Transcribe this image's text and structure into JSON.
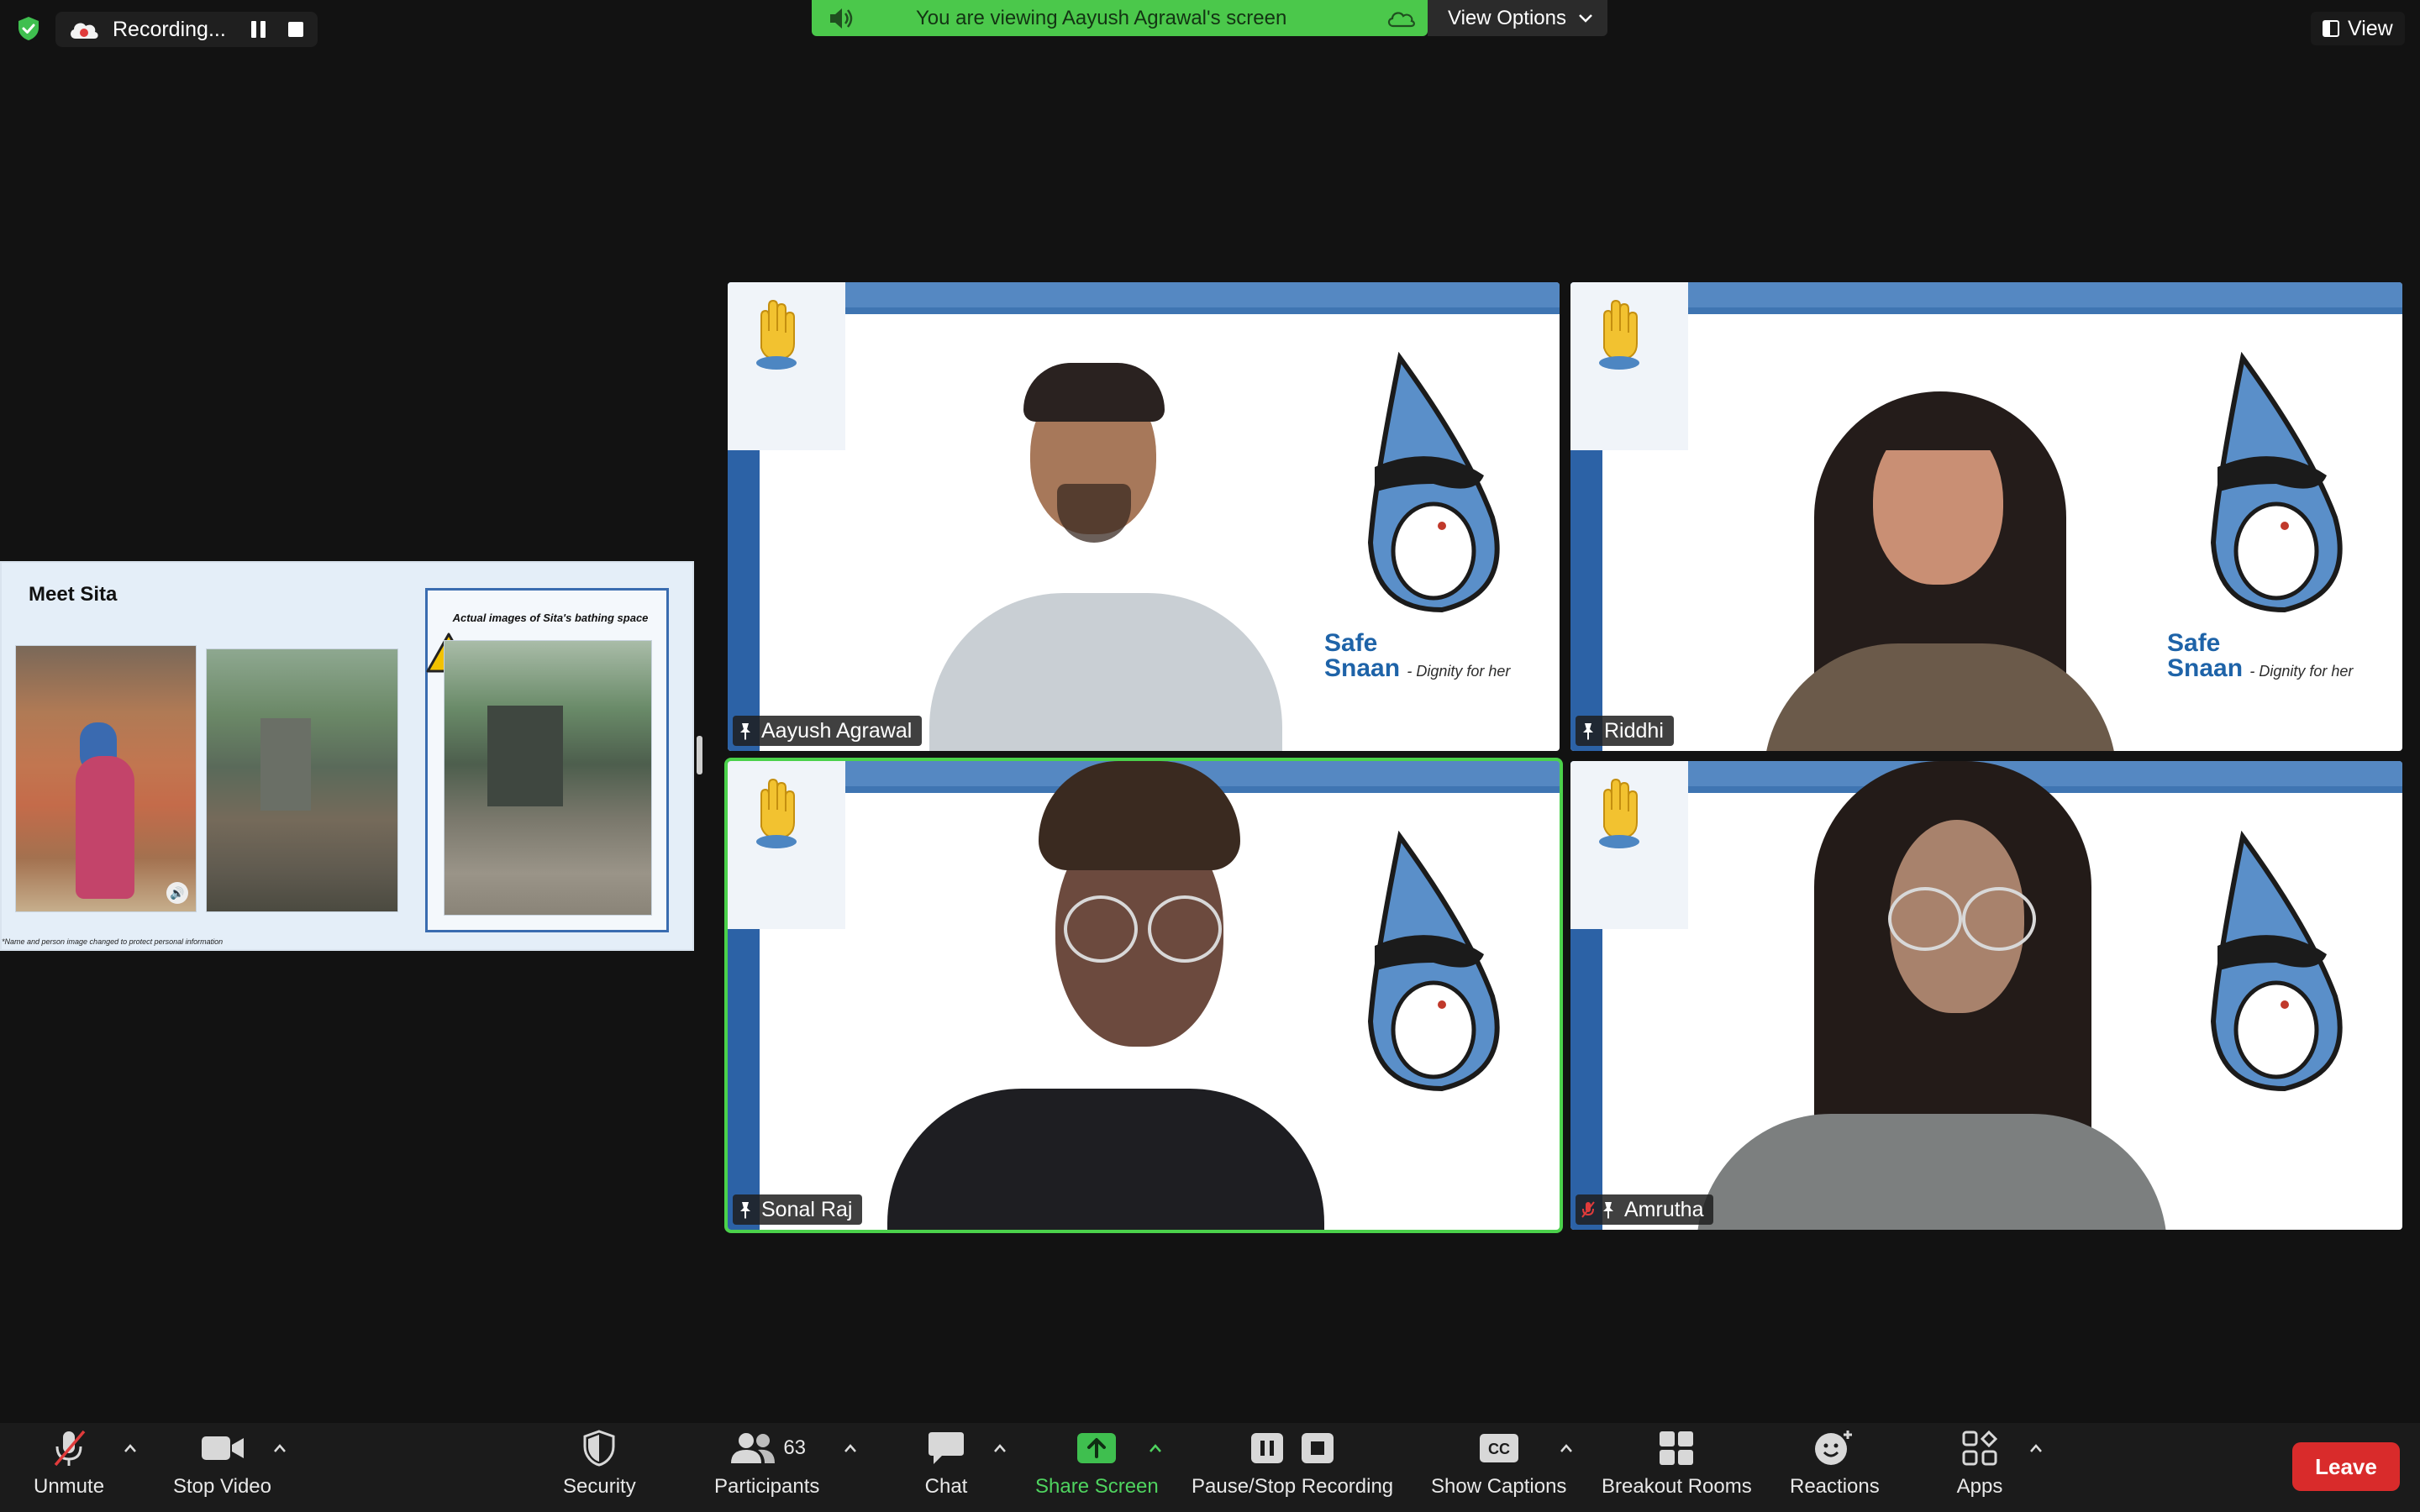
{
  "top_bar": {
    "recording_label": "Recording...",
    "viewing_message": "You are viewing Aayush Agrawal's screen",
    "view_options_label": "View Options",
    "view_label": "View"
  },
  "shared_slide": {
    "title": "Meet Sita",
    "frame_caption": "Actual images of Sita's bathing space",
    "footnote": "*Name and person image changed to protect personal information"
  },
  "tile_branding": {
    "line1": "Safe",
    "line2": "Snaan",
    "tagline": "- Dignity for her"
  },
  "participants": [
    {
      "name": "Aayush Agrawal",
      "muted": false,
      "active_speaker": false
    },
    {
      "name": "Riddhi",
      "muted": false,
      "active_speaker": false
    },
    {
      "name": "Sonal Raj",
      "muted": false,
      "active_speaker": true
    },
    {
      "name": "Amrutha",
      "muted": true,
      "active_speaker": false
    }
  ],
  "toolbar": {
    "unmute": "Unmute",
    "stop_video": "Stop Video",
    "security": "Security",
    "participants": "Participants",
    "participant_count": "63",
    "chat": "Chat",
    "share_screen": "Share Screen",
    "pause_stop_recording": "Pause/Stop Recording",
    "show_captions": "Show Captions",
    "breakout_rooms": "Breakout Rooms",
    "reactions": "Reactions",
    "apps": "Apps",
    "leave": "Leave",
    "captions_glyph": "CC"
  },
  "colors": {
    "viewing_banner": "#4bc84b",
    "active_border": "#4bd14b",
    "share_icon": "#3fbf4f",
    "leave_button": "#d92b2b",
    "slide_bg": "#e4eef8"
  }
}
